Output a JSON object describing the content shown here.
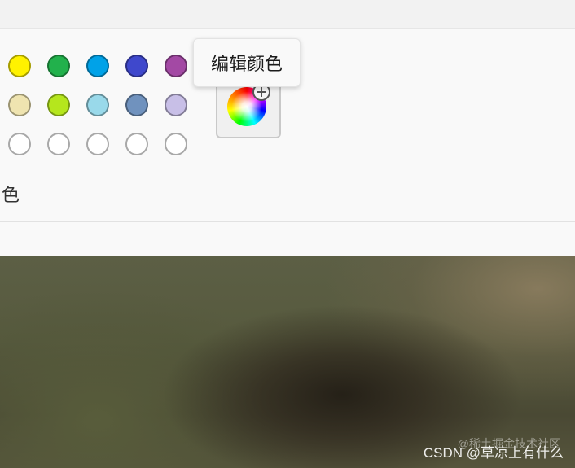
{
  "tooltip": {
    "text": "编辑颜色"
  },
  "section_label": "色",
  "swatches": [
    {
      "color": "#fff200",
      "state": "filled"
    },
    {
      "color": "#22b14c",
      "state": "filled"
    },
    {
      "color": "#00a2e8",
      "state": "filled"
    },
    {
      "color": "#3f48cc",
      "state": "filled"
    },
    {
      "color": "#a349a4",
      "state": "filled"
    },
    {
      "color": "#efe4b0",
      "state": "filled"
    },
    {
      "color": "#b5e61d",
      "state": "filled"
    },
    {
      "color": "#99d9ea",
      "state": "filled"
    },
    {
      "color": "#7092be",
      "state": "filled"
    },
    {
      "color": "#c8bfe7",
      "state": "filled"
    },
    {
      "color": "#ffffff",
      "state": "empty"
    },
    {
      "color": "#ffffff",
      "state": "empty"
    },
    {
      "color": "#ffffff",
      "state": "empty"
    },
    {
      "color": "#ffffff",
      "state": "empty"
    },
    {
      "color": "#ffffff",
      "state": "empty"
    }
  ],
  "edit_colors_button": {
    "icon": "color-wheel-icon",
    "badge_icon": "plus-circle-icon"
  },
  "watermark": {
    "text": "CSDN @草凉上有什么",
    "ghost_text": "@稀土掘金技术社区"
  }
}
